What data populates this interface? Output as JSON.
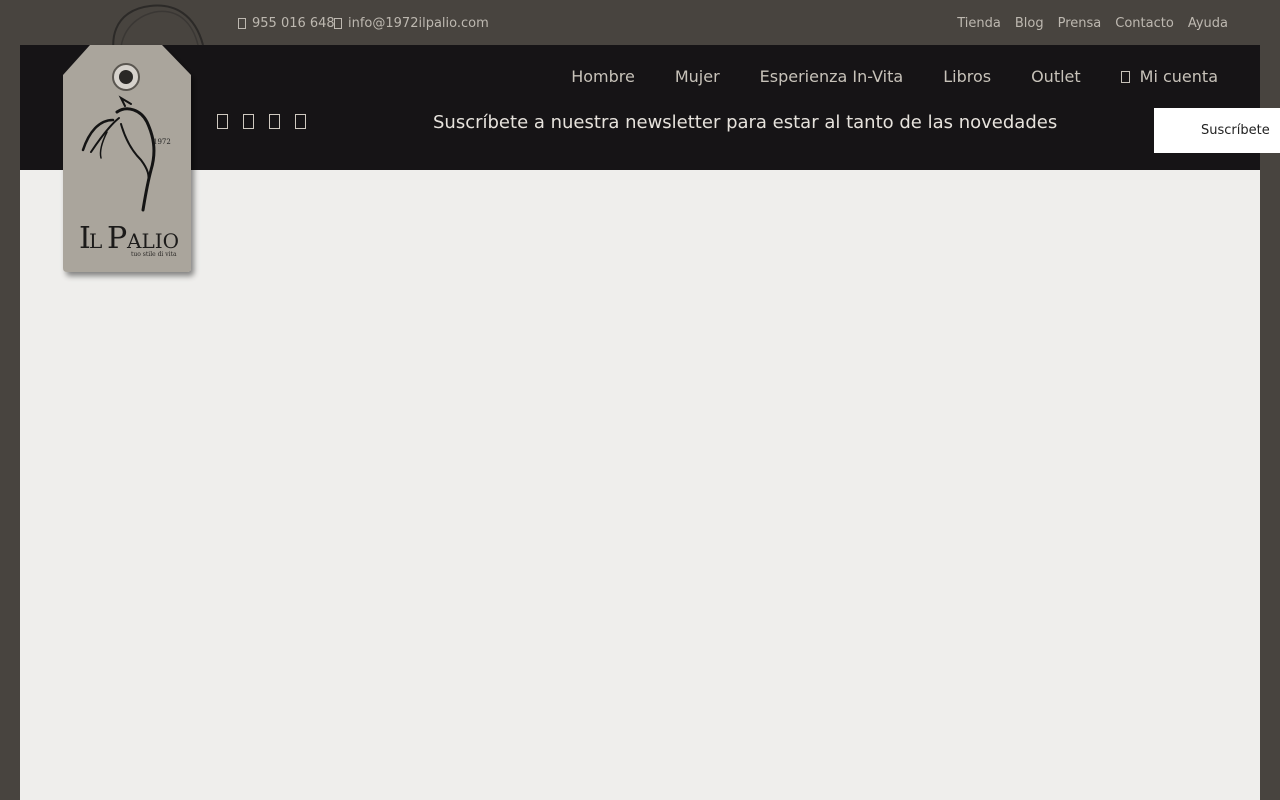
{
  "topbar": {
    "phone": "955 016 648",
    "email": "info@1972ilpalio.com",
    "links": [
      "Tienda",
      "Blog",
      "Prensa",
      "Contacto",
      "Ayuda"
    ]
  },
  "nav": {
    "items": [
      "Hombre",
      "Mujer",
      "Esperienza In-Vita",
      "Libros",
      "Outlet"
    ],
    "account": "Mi cuenta"
  },
  "newsletter": {
    "text": "Suscríbete a nuestra newsletter para estar al tanto de las novedades",
    "button": "Suscríbete"
  },
  "logo": {
    "name": "IL PALIO",
    "year": "1972",
    "tagline": "tuo stile di vita"
  },
  "social_icons": [
    "social-icon-1",
    "social-icon-2",
    "social-icon-3",
    "social-icon-4"
  ],
  "colors": {
    "page_bg": "#48443f",
    "header_bg": "#161416",
    "content_bg": "#efeeec",
    "tag": "#aaa59c"
  }
}
